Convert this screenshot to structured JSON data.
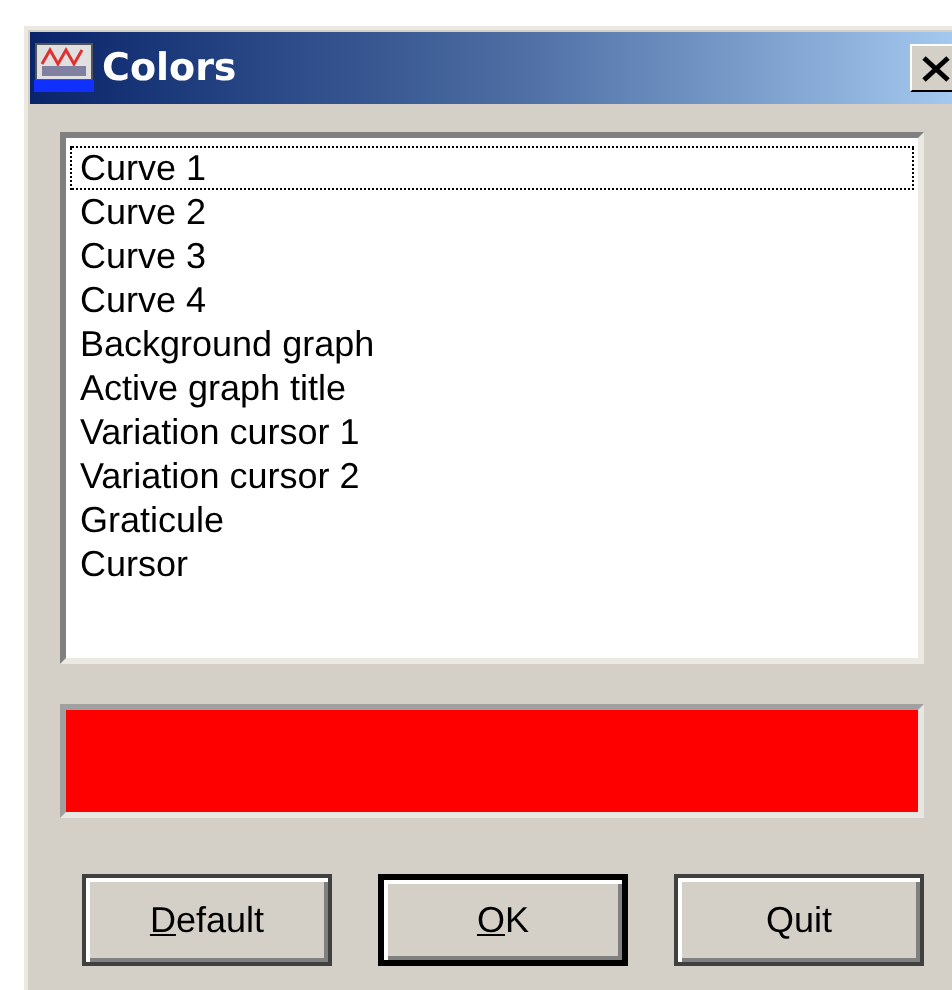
{
  "window": {
    "title": "Colors"
  },
  "list": {
    "items": [
      {
        "label": "Curve 1",
        "focused": true
      },
      {
        "label": "Curve 2",
        "focused": false
      },
      {
        "label": "Curve 3",
        "focused": false
      },
      {
        "label": "Curve 4",
        "focused": false
      },
      {
        "label": "Background graph",
        "focused": false
      },
      {
        "label": "Active graph title",
        "focused": false
      },
      {
        "label": "Variation cursor 1",
        "focused": false
      },
      {
        "label": "Variation cursor 2",
        "focused": false
      },
      {
        "label": "Graticule",
        "focused": false
      },
      {
        "label": "Cursor",
        "focused": false
      }
    ]
  },
  "swatch": {
    "color": "#ff0000"
  },
  "buttons": [
    {
      "label": "Default",
      "mnemonic": true,
      "default": false
    },
    {
      "label": "OK",
      "mnemonic": true,
      "default": true
    },
    {
      "label": "Quit",
      "mnemonic": false,
      "default": false
    }
  ]
}
